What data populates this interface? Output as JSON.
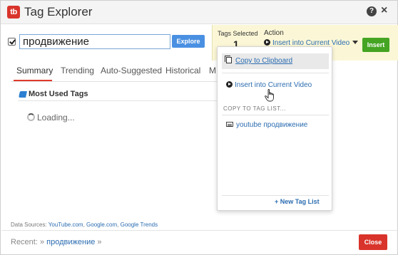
{
  "window": {
    "title": "Tag Explorer",
    "logo_text": "tb"
  },
  "search": {
    "value": "продвижение",
    "explore_label": "Explore",
    "checked": true
  },
  "action_panel": {
    "tags_selected_label": "Tags Selected",
    "tags_selected_count": "1",
    "action_label": "Action",
    "action_value": "Insert into Current Video",
    "insert_label": "Insert"
  },
  "tabs": [
    {
      "label": "Summary",
      "active": true
    },
    {
      "label": "Trending"
    },
    {
      "label": "Auto-Suggested"
    },
    {
      "label": "Historical"
    },
    {
      "label": "M"
    }
  ],
  "summary": {
    "section_title": "Most Used Tags",
    "loading_text": "Loading..."
  },
  "dropdown": {
    "copy_to_clipboard": "Copy to Clipboard",
    "insert_into_video": "Insert into Current Video",
    "copy_to_tag_list_header": "COPY TO TAG LIST...",
    "tag_list_item": "youtube продвижение",
    "new_tag_list": "+ New Tag List"
  },
  "footer": {
    "data_sources_label": "Data Sources:",
    "sources": [
      "YouTube.com",
      "Google.com",
      "Google Trends"
    ],
    "recent_label": "Recent:",
    "recent_item": "продвижение",
    "close_label": "Close"
  },
  "colors": {
    "accent_blue": "#4a90e2",
    "insert_green": "#45a523",
    "close_red": "#d9342b",
    "tab_underline": "#e03a2a",
    "panel_yellow": "#fbf7d6"
  }
}
